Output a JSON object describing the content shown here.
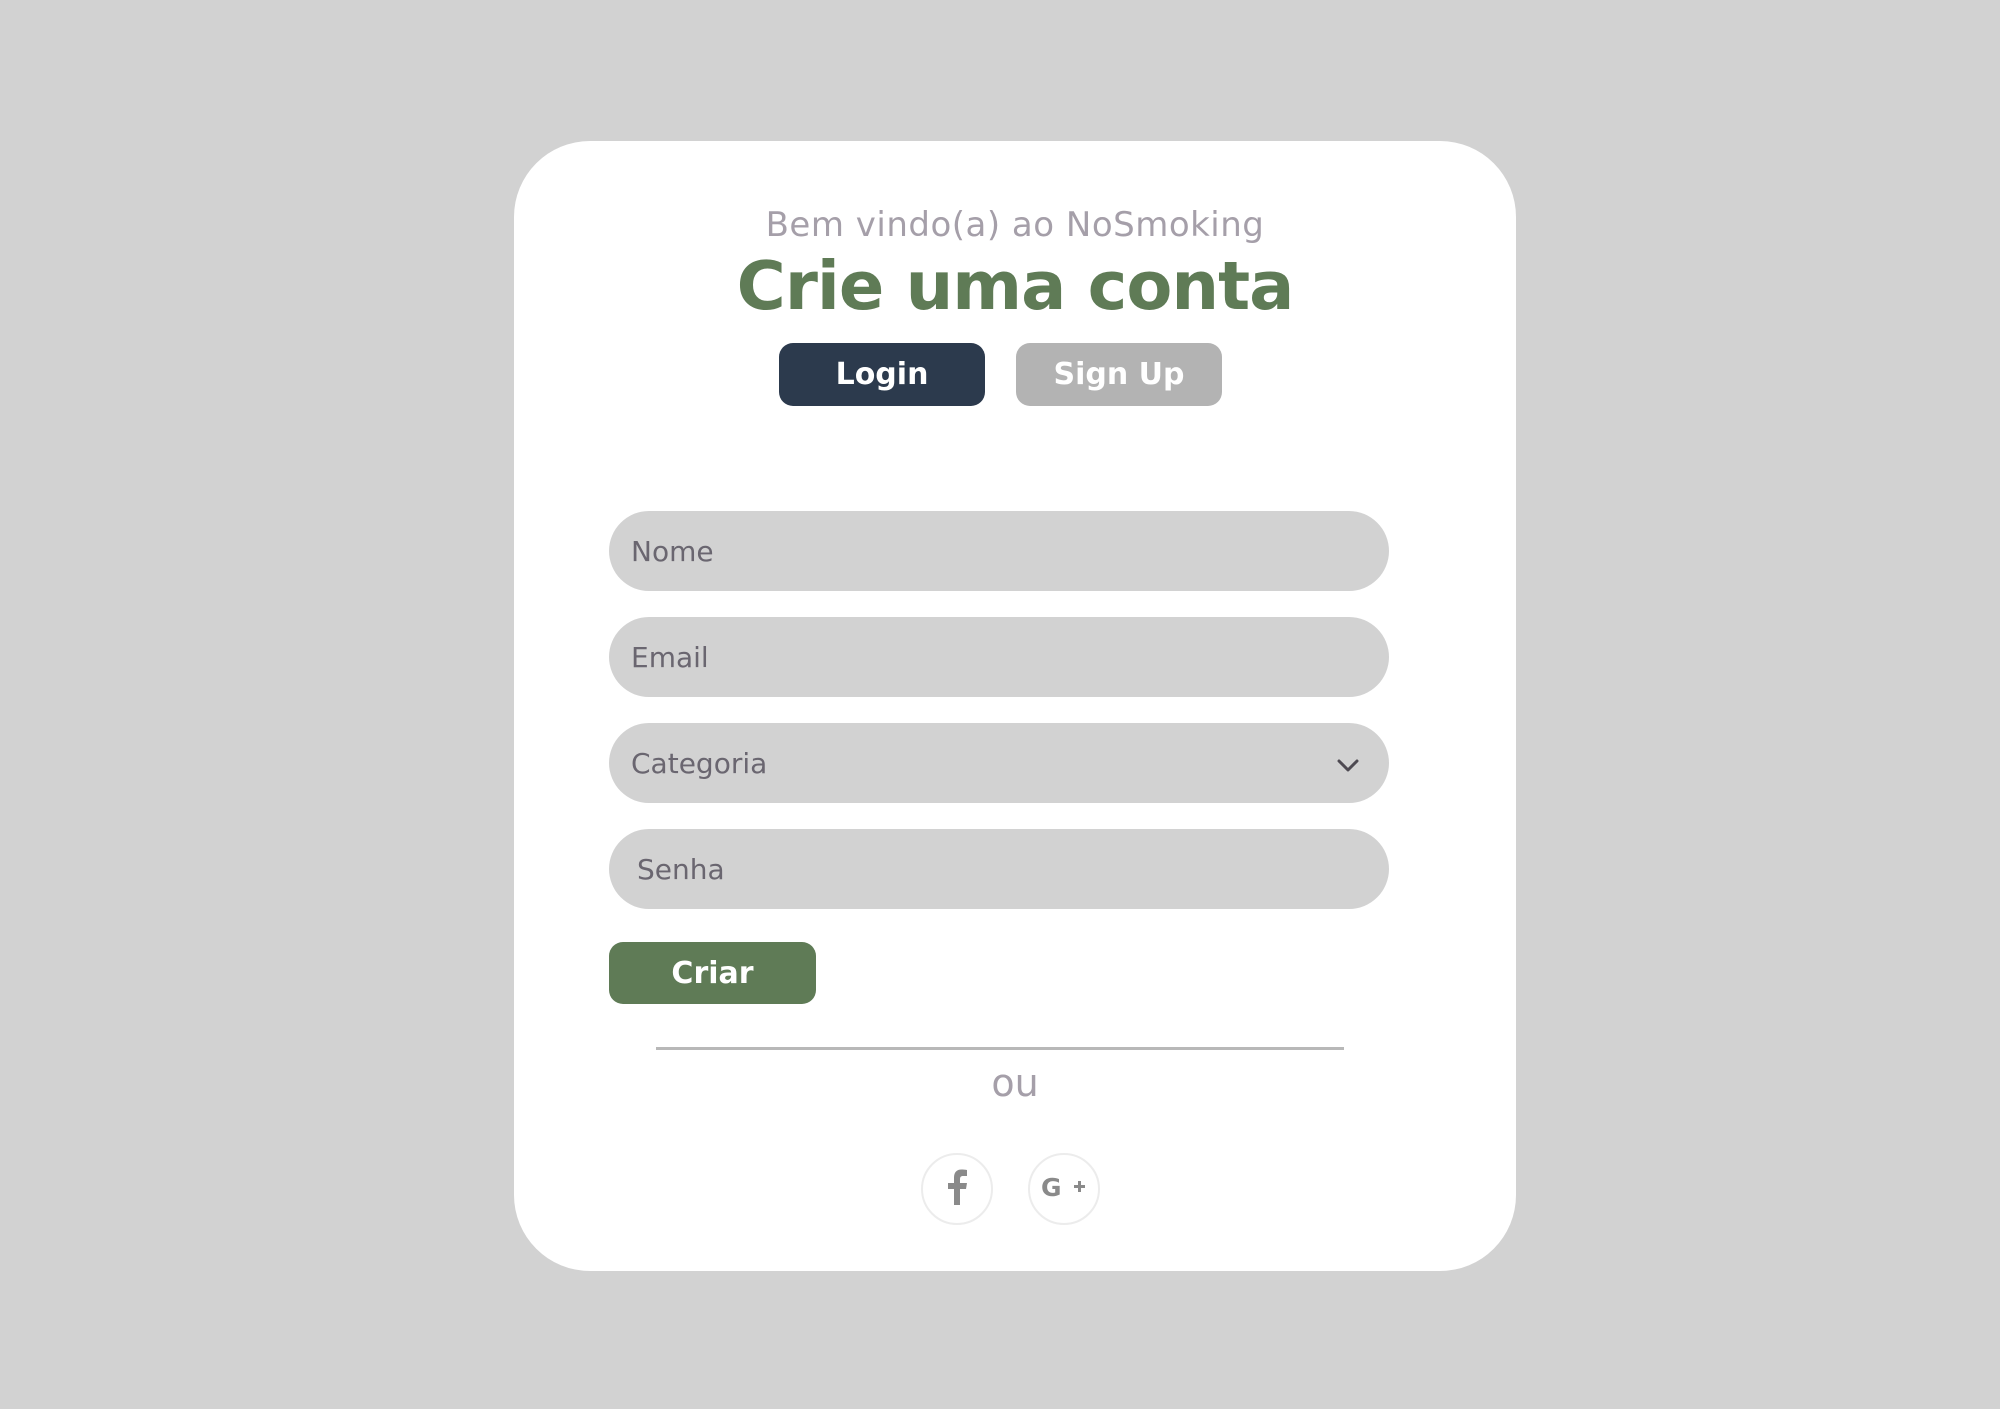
{
  "colors": {
    "page_background": "#d2d2d2",
    "card_background": "#ffffff",
    "brand_green": "#5f7b56",
    "navy": "#2c3a4d",
    "tab_inactive": "#b3b3b3",
    "muted_text": "#a59fa9",
    "field_background": "#d2d2d2"
  },
  "header": {
    "welcome": "Bem vindo(a) ao NoSmoking",
    "title": "Crie uma conta"
  },
  "tabs": [
    {
      "label": "Login",
      "icon": null
    },
    {
      "label": "Sign Up",
      "icon": null
    }
  ],
  "form": {
    "name_placeholder": "Nome",
    "email_placeholder": "Email",
    "category": {
      "selected": "Categoria",
      "icon": "chevron-down-icon"
    },
    "password_placeholder": "Senha",
    "submit_label": "Criar"
  },
  "divider": {
    "text": "ou"
  },
  "social": [
    {
      "name": "facebook",
      "icon": "facebook-icon"
    },
    {
      "name": "google-plus",
      "icon": "google-plus-icon"
    }
  ]
}
